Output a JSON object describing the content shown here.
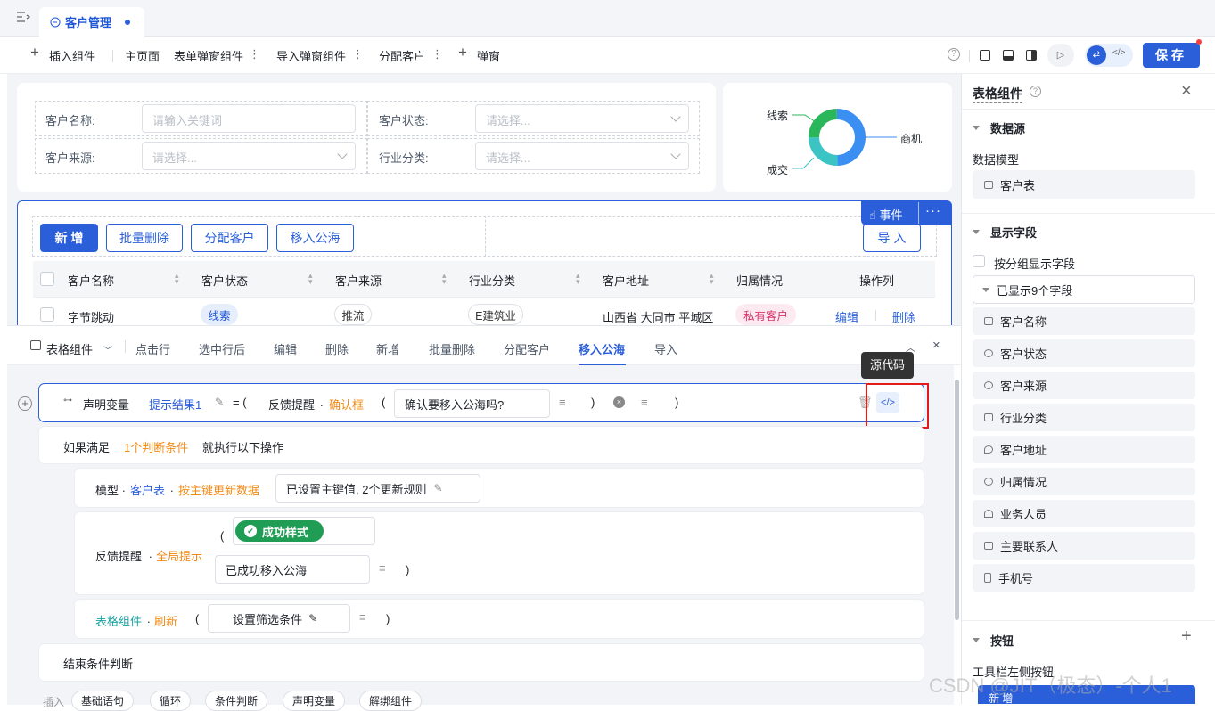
{
  "tab": {
    "title": "客户管理"
  },
  "toolbar": {
    "insert": "插入组件",
    "main_page": "主页面",
    "form_dialog": "表单弹窗组件",
    "import_dialog": "导入弹窗组件",
    "assign": "分配客户",
    "popup": "弹窗",
    "save": "保存"
  },
  "filters": {
    "name_label": "客户名称:",
    "name_placeholder": "请输入关键词",
    "status_label": "客户状态:",
    "status_placeholder": "请选择...",
    "source_label": "客户来源:",
    "source_placeholder": "请选择...",
    "industry_label": "行业分类:",
    "industry_placeholder": "请选择..."
  },
  "donut": {
    "labels": [
      "线索",
      "商机",
      "成交"
    ],
    "colors": [
      "#3b8ff3",
      "#2ab65a",
      "#3cc4c4"
    ]
  },
  "table_toolbar": {
    "add": "新 增",
    "batch_delete": "批量删除",
    "assign": "分配客户",
    "move_pool": "移入公海",
    "import": "导 入",
    "event": "事件"
  },
  "table": {
    "columns": [
      "客户名称",
      "客户状态",
      "客户来源",
      "行业分类",
      "客户地址",
      "归属情况",
      "操作列"
    ],
    "row": {
      "name": "字节跳动",
      "status": "线索",
      "source": "推流",
      "industry": "E建筑业",
      "address": "山西省 大同市 平城区",
      "owner": "私有客户",
      "edit": "编辑",
      "delete": "删除"
    }
  },
  "event_tabs": {
    "component": "表格组件",
    "items": [
      "点击行",
      "选中行后",
      "编辑",
      "删除",
      "新增",
      "批量删除",
      "分配客户",
      "移入公海",
      "导入"
    ],
    "active": "移入公海"
  },
  "tooltip": "源代码",
  "events": {
    "declare": {
      "label": "声明变量",
      "var": "提示结果1",
      "eq": "= (",
      "feedback": "反馈提醒",
      "dot": ".",
      "confirm": "确认框",
      "open": "(",
      "message": "确认要移入公海吗?",
      "close1": ")",
      "close2": ")"
    },
    "if": {
      "prefix": "如果满足",
      "cond": "1个判断条件",
      "suffix": "就执行以下操作"
    },
    "model": {
      "prefix": "模型",
      "dot1": ".",
      "model": "客户表",
      "dot2": ".",
      "action": "按主键更新数据",
      "value": "已设置主键值, 2个更新规则"
    },
    "feedback": {
      "prefix": "反馈提醒",
      "dot": ".",
      "action": "全局提示",
      "open": "(",
      "style": "成功样式",
      "message": "已成功移入公海",
      "close": ")"
    },
    "table_refresh": {
      "prefix": "表格组件",
      "dot": ".",
      "action": "刷新",
      "open": "(",
      "value": "设置筛选条件",
      "close": ")"
    },
    "end": "结束条件判断"
  },
  "bottom_tools": [
    "插入",
    "基础语句",
    "循环",
    "条件判断",
    "声明变量",
    "解绑组件"
  ],
  "sidebar": {
    "title": "表格组件",
    "datasource": "数据源",
    "model_label": "数据模型",
    "model": "客户表",
    "fields_title": "显示字段",
    "group_toggle": "按分组显示字段",
    "shown": "已显示9个字段",
    "fields": [
      "客户名称",
      "客户状态",
      "客户来源",
      "行业分类",
      "客户地址",
      "归属情况",
      "业务人员",
      "主要联系人",
      "手机号"
    ],
    "buttons_title": "按钮",
    "buttons_sub": "工具栏左侧按钮",
    "new_btn": "新 增"
  },
  "watermark": "CSDN @JIT（极态）-个人1"
}
